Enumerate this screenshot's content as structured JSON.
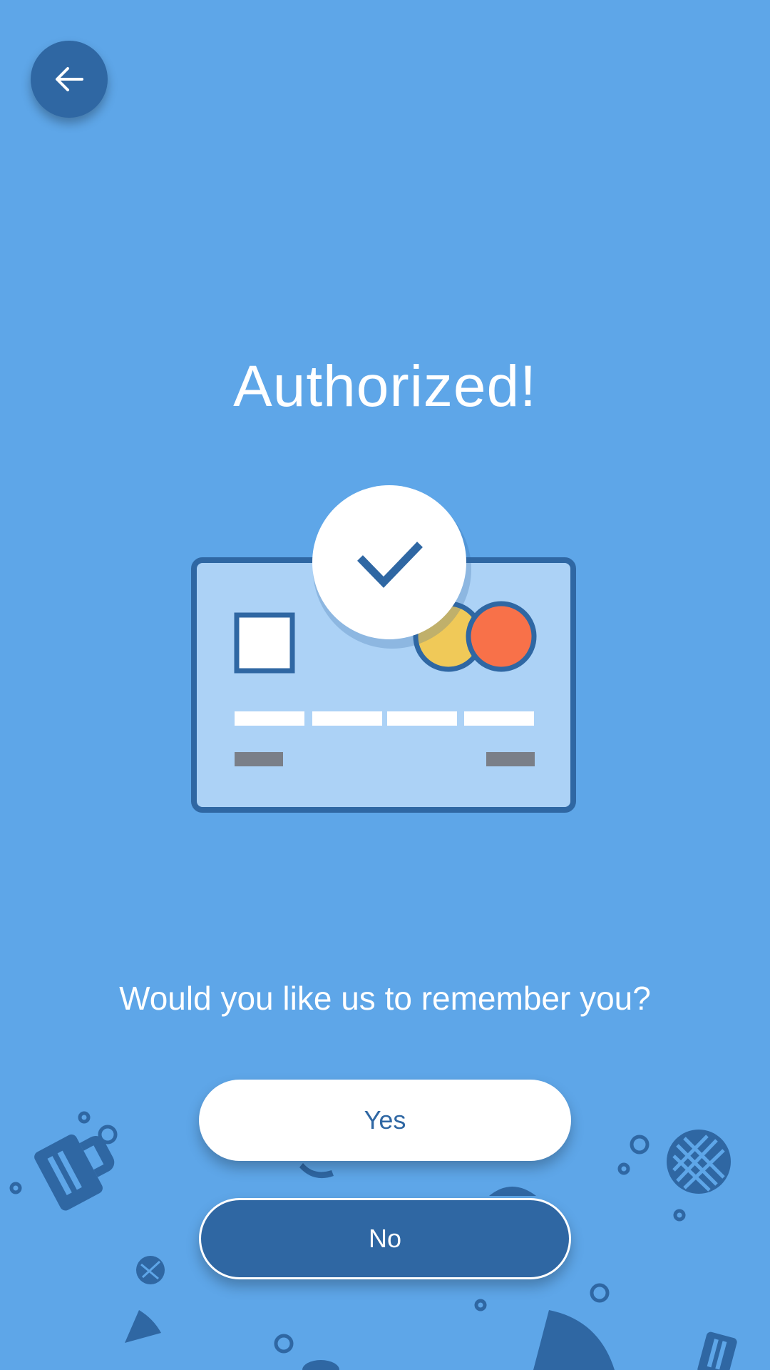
{
  "colors": {
    "background": "#5ea6e8",
    "dark_blue": "#2f67a3",
    "card_fill": "#acd2f6",
    "yellow_circle": "#f0c958",
    "orange_circle": "#f87149",
    "white": "#ffffff",
    "gray_bar": "#7a7f88"
  },
  "header": {
    "back_icon": "arrow-left-icon"
  },
  "main": {
    "title": "Authorized!",
    "illustration": {
      "card_icon": "credit-card-icon",
      "check_icon": "checkmark-icon"
    },
    "question": "Would you like us to remember you?"
  },
  "actions": {
    "yes_label": "Yes",
    "no_label": "No"
  },
  "background_icons": [
    "beer-mug-icon",
    "waffle-icon",
    "pizza-slice-icon",
    "bubble-icon"
  ]
}
